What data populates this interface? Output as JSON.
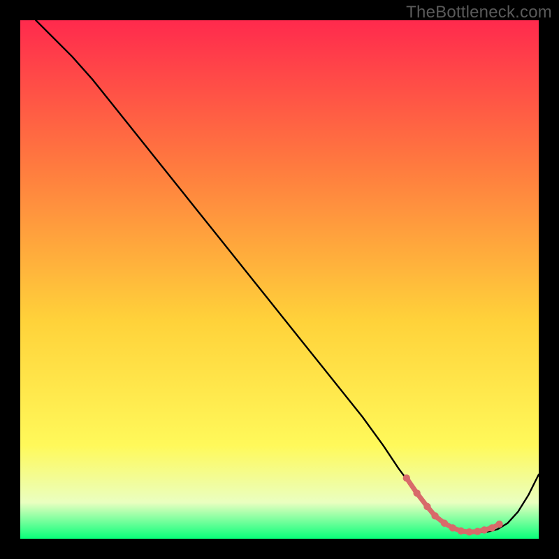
{
  "watermark": "TheBottleneck.com",
  "colors": {
    "gradient_top": "#ff2a4d",
    "gradient_mid1": "#ff7a3f",
    "gradient_mid2": "#ffd23a",
    "gradient_low": "#fff95a",
    "gradient_tint": "#eaffc0",
    "gradient_bottom": "#08ff7a",
    "curve": "#000000",
    "sweet_spot": "#d86a6a",
    "frame": "#000000"
  },
  "chart_data": {
    "type": "line",
    "title": "",
    "xlabel": "",
    "ylabel": "",
    "xlim": [
      0,
      100
    ],
    "ylim": [
      0,
      100
    ],
    "series": [
      {
        "name": "bottleneck-curve",
        "x": [
          3,
          6,
          10,
          14,
          18,
          22,
          26,
          30,
          34,
          38,
          42,
          46,
          50,
          54,
          58,
          62,
          66,
          70,
          73,
          76,
          79,
          80,
          82,
          84,
          86,
          88,
          90,
          92,
          94,
          96,
          98,
          100
        ],
        "y": [
          100,
          97,
          93,
          88.5,
          83.5,
          78.5,
          73.5,
          68.5,
          63.5,
          58.5,
          53.5,
          48.5,
          43.5,
          38.5,
          33.5,
          28.5,
          23.5,
          18,
          13.5,
          9.5,
          5.5,
          4.3,
          2.8,
          1.9,
          1.4,
          1.2,
          1.3,
          1.8,
          3.0,
          5.2,
          8.4,
          12.4
        ]
      }
    ],
    "sweet_spot_markers": {
      "name": "sweet-spot",
      "x": [
        74.5,
        76.5,
        78.5,
        80.0,
        81.8,
        83.4,
        85.0,
        86.6,
        88.2,
        89.5,
        91.0,
        92.4
      ],
      "y": [
        11.7,
        8.8,
        6.2,
        4.4,
        3.0,
        2.1,
        1.5,
        1.3,
        1.4,
        1.7,
        2.1,
        2.8
      ]
    }
  }
}
